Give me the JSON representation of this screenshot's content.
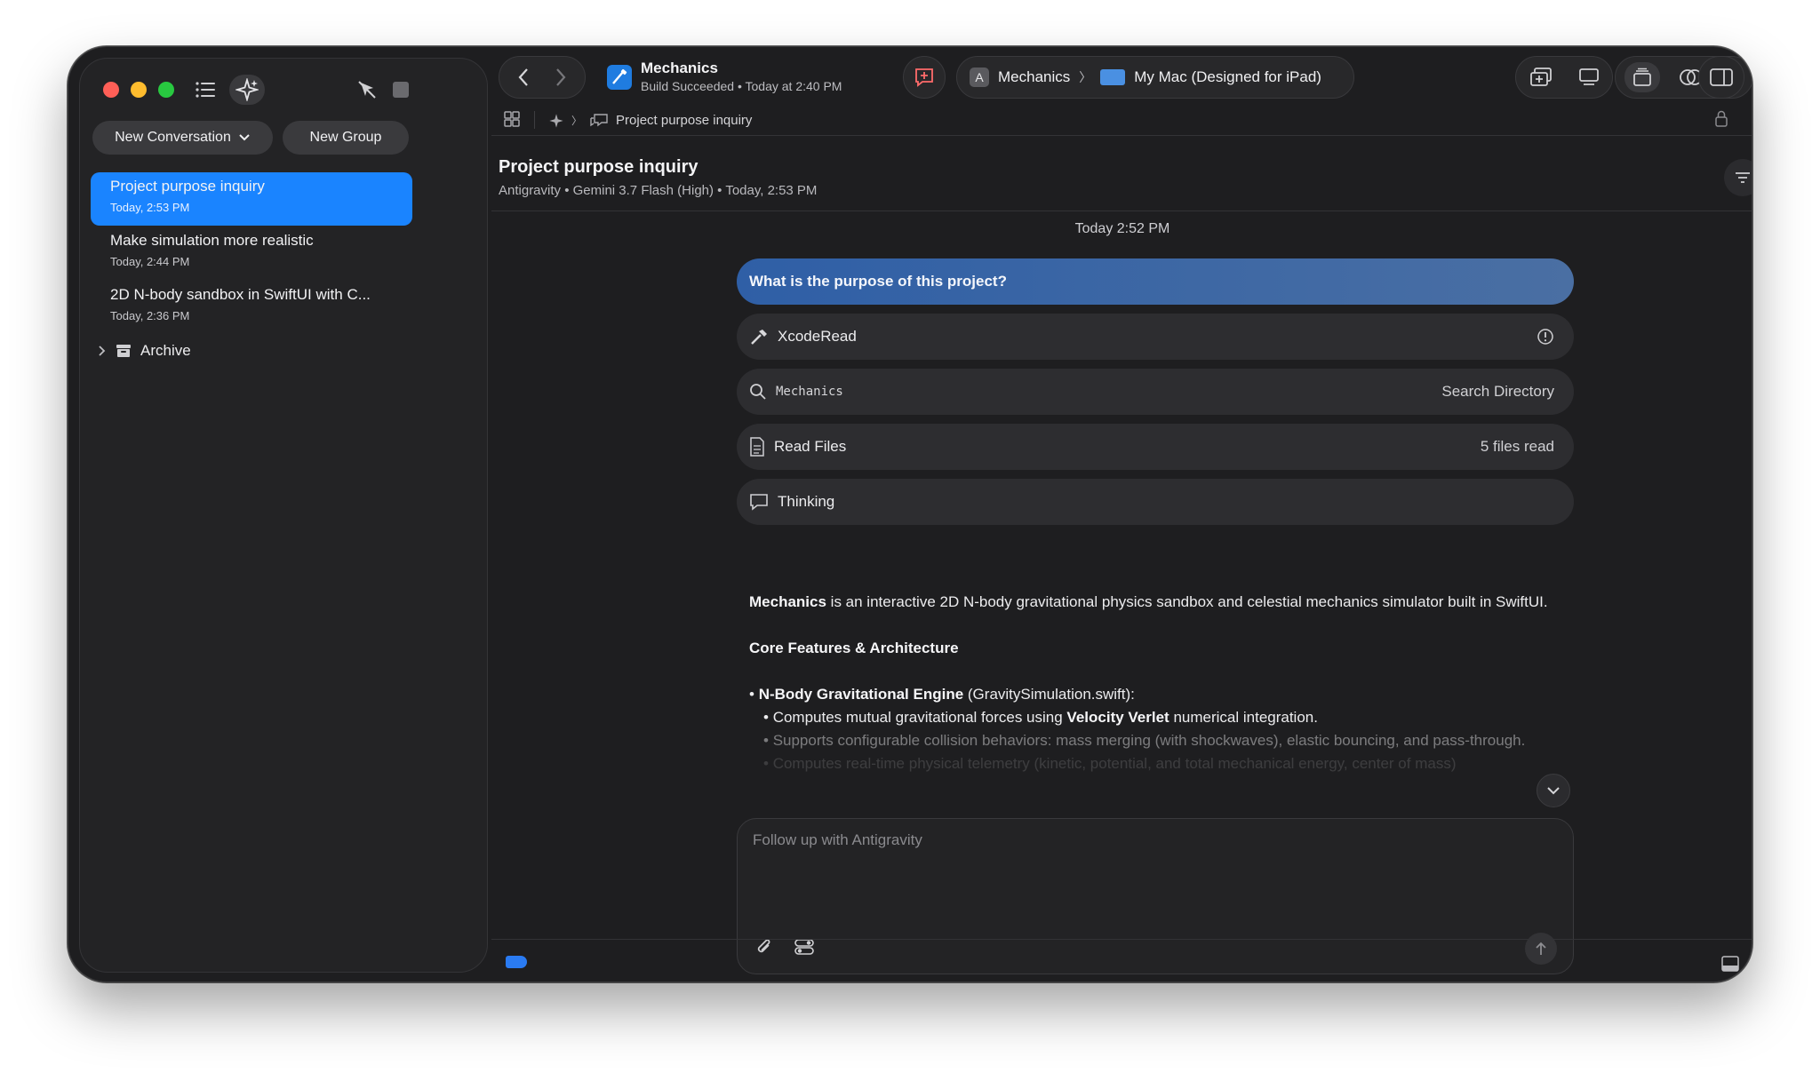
{
  "sidebar": {
    "new_conversation_label": "New Conversation",
    "new_group_label": "New Group",
    "conversations": [
      {
        "title": "Project purpose inquiry",
        "time": "Today, 2:53 PM",
        "active": true
      },
      {
        "title": "Make simulation more realistic",
        "time": "Today, 2:44 PM",
        "active": false
      },
      {
        "title": "2D N-body sandbox in SwiftUI with C...",
        "time": "Today, 2:36 PM",
        "active": false
      }
    ],
    "archive_label": "Archive"
  },
  "toolbar": {
    "project_name": "Mechanics",
    "build_status": "Build Succeeded • Today at 2:40 PM",
    "scheme_name": "Mechanics",
    "scheme_separator": "〉",
    "destination": "My Mac (Designed for iPad)",
    "scheme_icon_letter": "A"
  },
  "pathbar": {
    "crumb_separator": "〉",
    "current": "Project purpose inquiry"
  },
  "chat": {
    "title": "Project purpose inquiry",
    "subtitle": "Antigravity • Gemini 3.7 Flash (High) • Today, 2:53 PM",
    "timestamp": "Today 2:52 PM",
    "user_message": "What is the purpose of this project?",
    "tools": {
      "xcoderead": {
        "label": "XcodeRead"
      },
      "search": {
        "query": "Mechanics",
        "action": "Search Directory"
      },
      "read_files": {
        "label": "Read Files",
        "count": "5 files read"
      },
      "thinking": {
        "label": "Thinking"
      }
    },
    "answer": {
      "intro_bold": "Mechanics",
      "intro_rest": " is an interactive 2D N-body gravitational physics sandbox and celestial mechanics simulator built in SwiftUI.",
      "section_heading": "Core Features & Architecture",
      "bullet1_bold": "N-Body Gravitational Engine",
      "bullet1_rest": " (GravitySimulation.swift):",
      "sub1_pre": "Computes mutual gravitational forces using ",
      "sub1_bold": "Velocity Verlet",
      "sub1_post": " numerical integration.",
      "sub2": "Supports configurable collision behaviors: mass merging (with shockwaves), elastic bouncing, and pass-through.",
      "sub3": "Computes real-time physical telemetry (kinetic, potential, and total mechanical energy, center of mass)"
    }
  },
  "composer": {
    "placeholder": "Follow up with Antigravity"
  },
  "colors": {
    "accent": "#1a84ff",
    "user_bubble": "#2f5fa6",
    "window_bg": "#1e1e20"
  },
  "icons": [
    "list-icon",
    "sparkle-icon",
    "pointer-off-icon",
    "stop-icon",
    "chevron-left-icon",
    "chevron-right-icon",
    "xcode-app-icon",
    "feedback-icon",
    "mac-laptop-icon",
    "add-window-icon",
    "device-icon",
    "library-icon",
    "overlap-icon",
    "swap-icon",
    "inspector-icon",
    "grid-icon",
    "lock-icon",
    "filter-icon",
    "more-icon",
    "hammer-icon",
    "info-icon",
    "search-icon",
    "document-icon",
    "chat-bubble-icon",
    "chevron-down-icon",
    "paperclip-icon",
    "toggles-icon",
    "send-arrow-icon",
    "archive-box-icon",
    "bottom-panel-icon"
  ]
}
